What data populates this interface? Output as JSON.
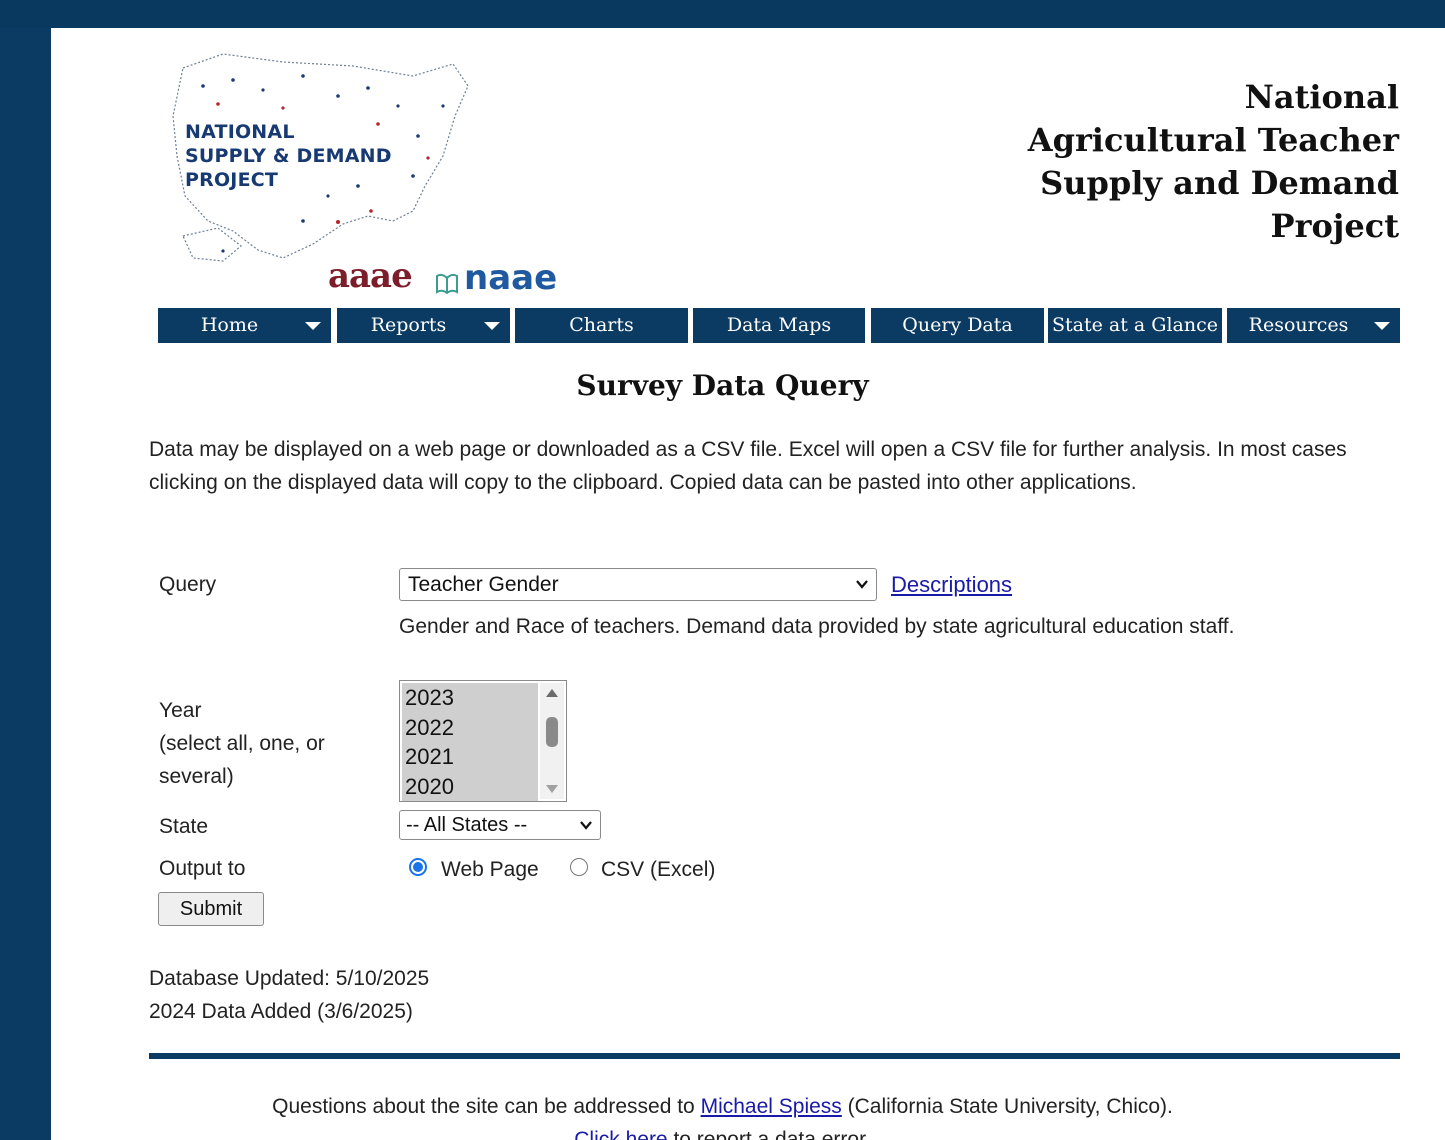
{
  "logo": {
    "line1": "NATIONAL",
    "line2": "SUPPLY & DEMAND",
    "line3": "PROJECT",
    "org1": "aaae",
    "org2": "naae"
  },
  "site_title": {
    "line1": "National",
    "line2": "Agricultural Teacher",
    "line3": "Supply and Demand",
    "line4": "Project"
  },
  "nav": [
    {
      "label": "Home",
      "dropdown": true
    },
    {
      "label": "Reports",
      "dropdown": true
    },
    {
      "label": "Charts",
      "dropdown": false
    },
    {
      "label": "Data Maps",
      "dropdown": false
    },
    {
      "label": "Query Data",
      "dropdown": false
    },
    {
      "label": "State at a Glance",
      "dropdown": false
    },
    {
      "label": "Resources",
      "dropdown": true
    }
  ],
  "heading": "Survey Data Query",
  "intro": "Data may be displayed on a web page or downloaded as a CSV file.   Excel will open a CSV file for further analysis. In most cases clicking on the displayed data will copy to the clipboard.  Copied data can be pasted into other applications.",
  "form": {
    "query_label": "Query",
    "query_value": "Teacher Gender",
    "descriptions_link": "Descriptions",
    "query_description": "Gender and Race of teachers. Demand data provided by state agricultural education staff.",
    "year_label": "Year",
    "year_hint": "(select all, one, or several)",
    "years": [
      "2023",
      "2022",
      "2021",
      "2020"
    ],
    "state_label": "State",
    "state_value": "-- All States --",
    "output_label": "Output to",
    "output_options": [
      "Web Page",
      "CSV (Excel)"
    ],
    "output_selected": "Web Page",
    "submit_label": "Submit"
  },
  "db_info": {
    "updated": "Database Updated: 5/10/2025",
    "added": "2024 Data Added (3/6/2025)"
  },
  "footer": {
    "prefix": "Questions about the site can be addressed to ",
    "contact_link": "Michael Spiess",
    "suffix": " (California State University, Chico).",
    "report_link": "Click here",
    "report_suffix": " to report a data error."
  },
  "colors": {
    "navy": "#0b3a63",
    "link": "#1a1aa8",
    "radio": "#1a73e8"
  }
}
